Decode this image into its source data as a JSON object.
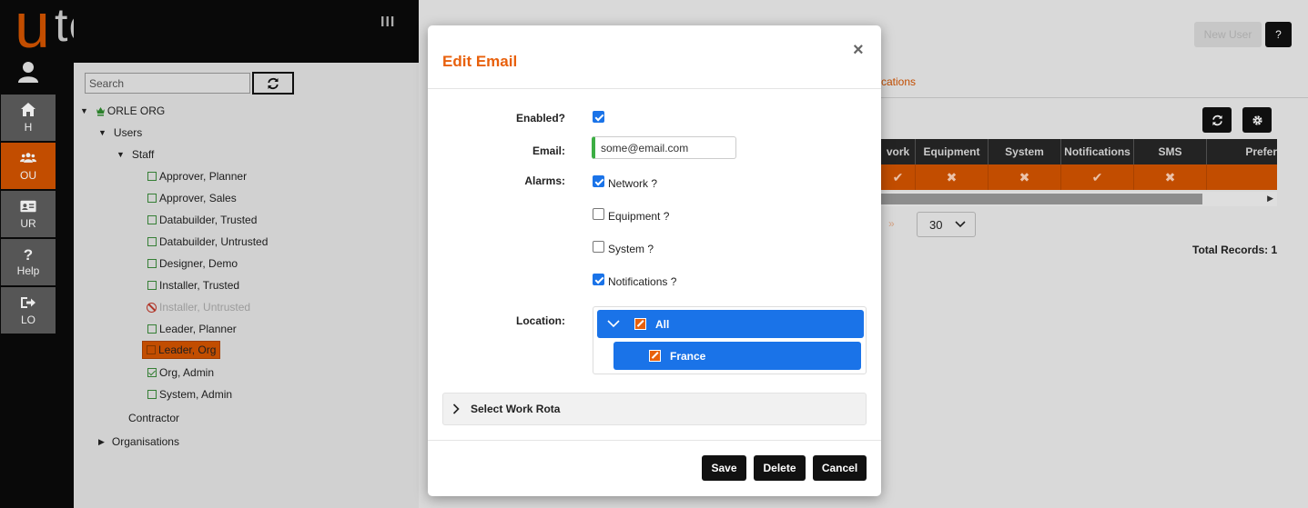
{
  "app": {
    "logo_u": "u",
    "logo_rest": "tel",
    "menu_glyph": "III"
  },
  "nav": [
    {
      "label": "H",
      "icon": "home-icon"
    },
    {
      "label": "OU",
      "icon": "users-icon",
      "active": true
    },
    {
      "label": "UR",
      "icon": "id-card-icon"
    },
    {
      "label": "Help",
      "icon": "question-icon"
    },
    {
      "label": "LO",
      "icon": "logout-icon"
    }
  ],
  "tree": {
    "search_placeholder": "Search",
    "root": "ORLE ORG",
    "users": "Users",
    "staff": "Staff",
    "staff_items": [
      "Approver, Planner",
      "Approver, Sales",
      "Databuilder, Trusted",
      "Databuilder, Untrusted",
      "Designer, Demo",
      "Installer, Trusted",
      "Installer, Untrusted",
      "Leader, Planner",
      "Leader, Org",
      "Org, Admin",
      "System, Admin"
    ],
    "contractor": "Contractor",
    "organisations": "Organisations"
  },
  "background": {
    "new_user": "New User",
    "help": "?",
    "tab_fragment": "cations",
    "grid_headers": [
      "vork",
      "Equipment",
      "System",
      "Notifications",
      "SMS",
      "Prefer"
    ],
    "grid_row": [
      "✔",
      "✖",
      "✖",
      "✔",
      "✖",
      ""
    ],
    "pager_next": "»",
    "page_size": "30",
    "total_records": "Total Records: 1"
  },
  "modal": {
    "title": "Edit Email",
    "close": "×",
    "enabled_label": "Enabled?",
    "email_label": "Email:",
    "email_value": "some@email.com",
    "alarms_label": "Alarms:",
    "alarms": [
      {
        "label": "Network ?",
        "checked": true
      },
      {
        "label": "Equipment ?",
        "checked": false
      },
      {
        "label": "System ?",
        "checked": false
      },
      {
        "label": "Notifications ?",
        "checked": true
      }
    ],
    "location_label": "Location:",
    "locations": [
      "All",
      "France"
    ],
    "work_rota": "Select Work Rota",
    "save": "Save",
    "delete": "Delete",
    "cancel": "Cancel"
  },
  "colors": {
    "brand_orange": "#d35400",
    "title_orange": "#e8600c",
    "primary_blue": "#1a73e8",
    "enabled_green": "#3cae44"
  }
}
